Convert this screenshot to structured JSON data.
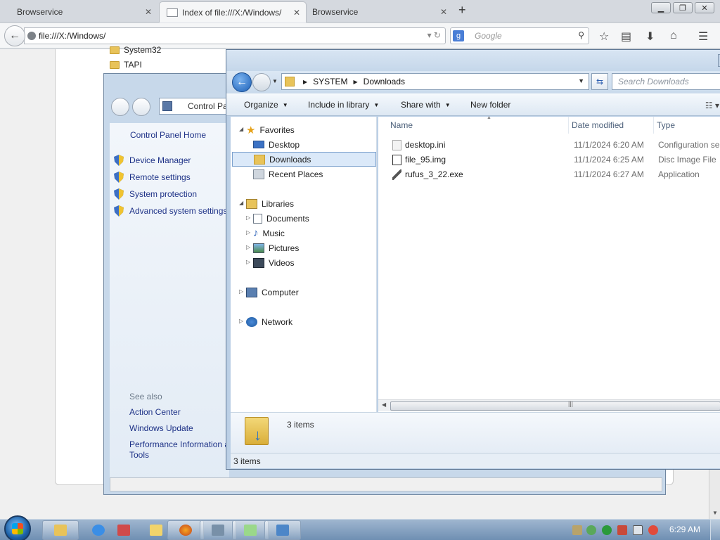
{
  "browser": {
    "tabs": [
      {
        "label": "Browservice",
        "active": false
      },
      {
        "label": "Index of file:///X:/Windows/",
        "active": true
      },
      {
        "label": "Browservice",
        "active": false
      }
    ],
    "new_tab": "+",
    "url": "file:///X:/Windows/",
    "search_placeholder": "Google",
    "search_engine_badge": "g",
    "window_controls": [
      "minimize",
      "restore",
      "close"
    ]
  },
  "page": {
    "folders": [
      "System32",
      "TAPI"
    ]
  },
  "control_panel": {
    "address_text": "Control Panel",
    "home_link": "Control Panel Home",
    "links": [
      "Device Manager",
      "Remote settings",
      "System protection",
      "Advanced system settings"
    ],
    "see_also_label": "See also",
    "see_also": [
      "Action Center",
      "Windows Update",
      "Performance Information and",
      "Tools"
    ]
  },
  "explorer": {
    "breadcrumb": [
      "SYSTEM",
      "Downloads"
    ],
    "search_placeholder": "Search Downloads",
    "toolbar": {
      "organize": "Organize",
      "include_in_library": "Include in library",
      "share_with": "Share with",
      "new_folder": "New folder"
    },
    "nav": {
      "favorites": "Favorites",
      "desktop": "Desktop",
      "downloads": "Downloads",
      "recent_places": "Recent Places",
      "libraries": "Libraries",
      "documents": "Documents",
      "music": "Music",
      "pictures": "Pictures",
      "videos": "Videos",
      "computer": "Computer",
      "network": "Network"
    },
    "columns": {
      "name": "Name",
      "date_modified": "Date modified",
      "type": "Type"
    },
    "files": [
      {
        "name": "desktop.ini",
        "date": "11/1/2024 6:20 AM",
        "type": "Configuration se",
        "icon": "ini-file-icon"
      },
      {
        "name": "file_95.img",
        "date": "11/1/2024 6:25 AM",
        "type": "Disc Image File",
        "icon": "disc-image-icon"
      },
      {
        "name": "rufus_3_22.exe",
        "date": "11/1/2024 6:27 AM",
        "type": "Application",
        "icon": "exe-icon"
      }
    ],
    "details_count": "3 items",
    "status_count": "3 items"
  },
  "taskbar": {
    "pinned": [
      "explorer",
      "ie",
      "network-app",
      "paint",
      "firefox",
      "control-panel",
      "rufus",
      "remote-desktop"
    ],
    "clock": "6:29 AM"
  }
}
